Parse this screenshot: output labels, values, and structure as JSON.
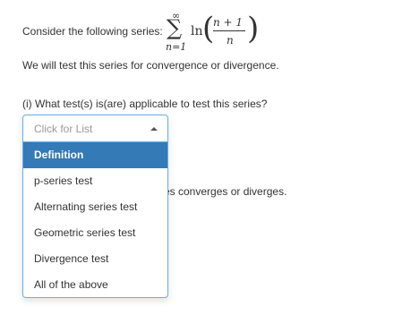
{
  "question": {
    "intro": "Consider the following series:",
    "math": {
      "sum_upper": "∞",
      "sum_symbol": "∑",
      "sum_lower": "n=1",
      "func": "ln",
      "numerator": "n + 1",
      "denominator": "n"
    },
    "test_statement": "We will test this series for convergence or divergence.",
    "part_i": "(i) What test(s) is(are) applicable to test this series?",
    "hidden_text": "es converges or diverges."
  },
  "dropdown": {
    "placeholder": "Click for List",
    "options": [
      "Definition",
      "p-series test",
      "Alternating series test",
      "Geometric series test",
      "Divergence test",
      "All of the above"
    ],
    "highlighted_index": 0,
    "colors": {
      "highlight": "#337ab7",
      "border": "#66afe9"
    }
  }
}
